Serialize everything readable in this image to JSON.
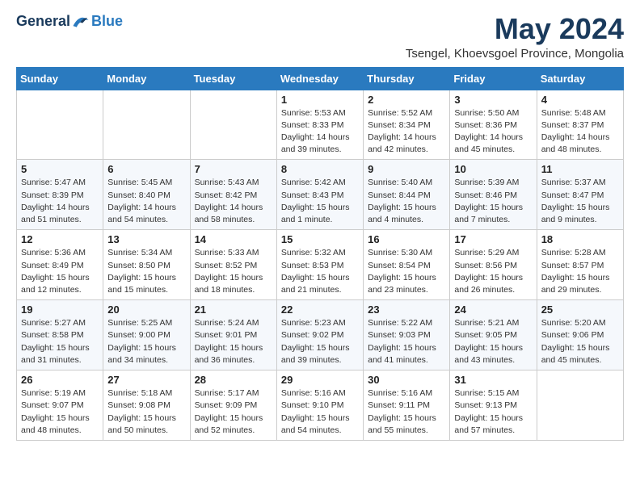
{
  "header": {
    "logo": {
      "general": "General",
      "blue": "Blue"
    },
    "title": "May 2024",
    "subtitle": "Tsengel, Khoevsgoel Province, Mongolia"
  },
  "weekdays": [
    "Sunday",
    "Monday",
    "Tuesday",
    "Wednesday",
    "Thursday",
    "Friday",
    "Saturday"
  ],
  "weeks": [
    [
      {
        "day": "",
        "info": ""
      },
      {
        "day": "",
        "info": ""
      },
      {
        "day": "",
        "info": ""
      },
      {
        "day": "1",
        "info": "Sunrise: 5:53 AM\nSunset: 8:33 PM\nDaylight: 14 hours\nand 39 minutes."
      },
      {
        "day": "2",
        "info": "Sunrise: 5:52 AM\nSunset: 8:34 PM\nDaylight: 14 hours\nand 42 minutes."
      },
      {
        "day": "3",
        "info": "Sunrise: 5:50 AM\nSunset: 8:36 PM\nDaylight: 14 hours\nand 45 minutes."
      },
      {
        "day": "4",
        "info": "Sunrise: 5:48 AM\nSunset: 8:37 PM\nDaylight: 14 hours\nand 48 minutes."
      }
    ],
    [
      {
        "day": "5",
        "info": "Sunrise: 5:47 AM\nSunset: 8:39 PM\nDaylight: 14 hours\nand 51 minutes."
      },
      {
        "day": "6",
        "info": "Sunrise: 5:45 AM\nSunset: 8:40 PM\nDaylight: 14 hours\nand 54 minutes."
      },
      {
        "day": "7",
        "info": "Sunrise: 5:43 AM\nSunset: 8:42 PM\nDaylight: 14 hours\nand 58 minutes."
      },
      {
        "day": "8",
        "info": "Sunrise: 5:42 AM\nSunset: 8:43 PM\nDaylight: 15 hours\nand 1 minute."
      },
      {
        "day": "9",
        "info": "Sunrise: 5:40 AM\nSunset: 8:44 PM\nDaylight: 15 hours\nand 4 minutes."
      },
      {
        "day": "10",
        "info": "Sunrise: 5:39 AM\nSunset: 8:46 PM\nDaylight: 15 hours\nand 7 minutes."
      },
      {
        "day": "11",
        "info": "Sunrise: 5:37 AM\nSunset: 8:47 PM\nDaylight: 15 hours\nand 9 minutes."
      }
    ],
    [
      {
        "day": "12",
        "info": "Sunrise: 5:36 AM\nSunset: 8:49 PM\nDaylight: 15 hours\nand 12 minutes."
      },
      {
        "day": "13",
        "info": "Sunrise: 5:34 AM\nSunset: 8:50 PM\nDaylight: 15 hours\nand 15 minutes."
      },
      {
        "day": "14",
        "info": "Sunrise: 5:33 AM\nSunset: 8:52 PM\nDaylight: 15 hours\nand 18 minutes."
      },
      {
        "day": "15",
        "info": "Sunrise: 5:32 AM\nSunset: 8:53 PM\nDaylight: 15 hours\nand 21 minutes."
      },
      {
        "day": "16",
        "info": "Sunrise: 5:30 AM\nSunset: 8:54 PM\nDaylight: 15 hours\nand 23 minutes."
      },
      {
        "day": "17",
        "info": "Sunrise: 5:29 AM\nSunset: 8:56 PM\nDaylight: 15 hours\nand 26 minutes."
      },
      {
        "day": "18",
        "info": "Sunrise: 5:28 AM\nSunset: 8:57 PM\nDaylight: 15 hours\nand 29 minutes."
      }
    ],
    [
      {
        "day": "19",
        "info": "Sunrise: 5:27 AM\nSunset: 8:58 PM\nDaylight: 15 hours\nand 31 minutes."
      },
      {
        "day": "20",
        "info": "Sunrise: 5:25 AM\nSunset: 9:00 PM\nDaylight: 15 hours\nand 34 minutes."
      },
      {
        "day": "21",
        "info": "Sunrise: 5:24 AM\nSunset: 9:01 PM\nDaylight: 15 hours\nand 36 minutes."
      },
      {
        "day": "22",
        "info": "Sunrise: 5:23 AM\nSunset: 9:02 PM\nDaylight: 15 hours\nand 39 minutes."
      },
      {
        "day": "23",
        "info": "Sunrise: 5:22 AM\nSunset: 9:03 PM\nDaylight: 15 hours\nand 41 minutes."
      },
      {
        "day": "24",
        "info": "Sunrise: 5:21 AM\nSunset: 9:05 PM\nDaylight: 15 hours\nand 43 minutes."
      },
      {
        "day": "25",
        "info": "Sunrise: 5:20 AM\nSunset: 9:06 PM\nDaylight: 15 hours\nand 45 minutes."
      }
    ],
    [
      {
        "day": "26",
        "info": "Sunrise: 5:19 AM\nSunset: 9:07 PM\nDaylight: 15 hours\nand 48 minutes."
      },
      {
        "day": "27",
        "info": "Sunrise: 5:18 AM\nSunset: 9:08 PM\nDaylight: 15 hours\nand 50 minutes."
      },
      {
        "day": "28",
        "info": "Sunrise: 5:17 AM\nSunset: 9:09 PM\nDaylight: 15 hours\nand 52 minutes."
      },
      {
        "day": "29",
        "info": "Sunrise: 5:16 AM\nSunset: 9:10 PM\nDaylight: 15 hours\nand 54 minutes."
      },
      {
        "day": "30",
        "info": "Sunrise: 5:16 AM\nSunset: 9:11 PM\nDaylight: 15 hours\nand 55 minutes."
      },
      {
        "day": "31",
        "info": "Sunrise: 5:15 AM\nSunset: 9:13 PM\nDaylight: 15 hours\nand 57 minutes."
      },
      {
        "day": "",
        "info": ""
      }
    ]
  ]
}
